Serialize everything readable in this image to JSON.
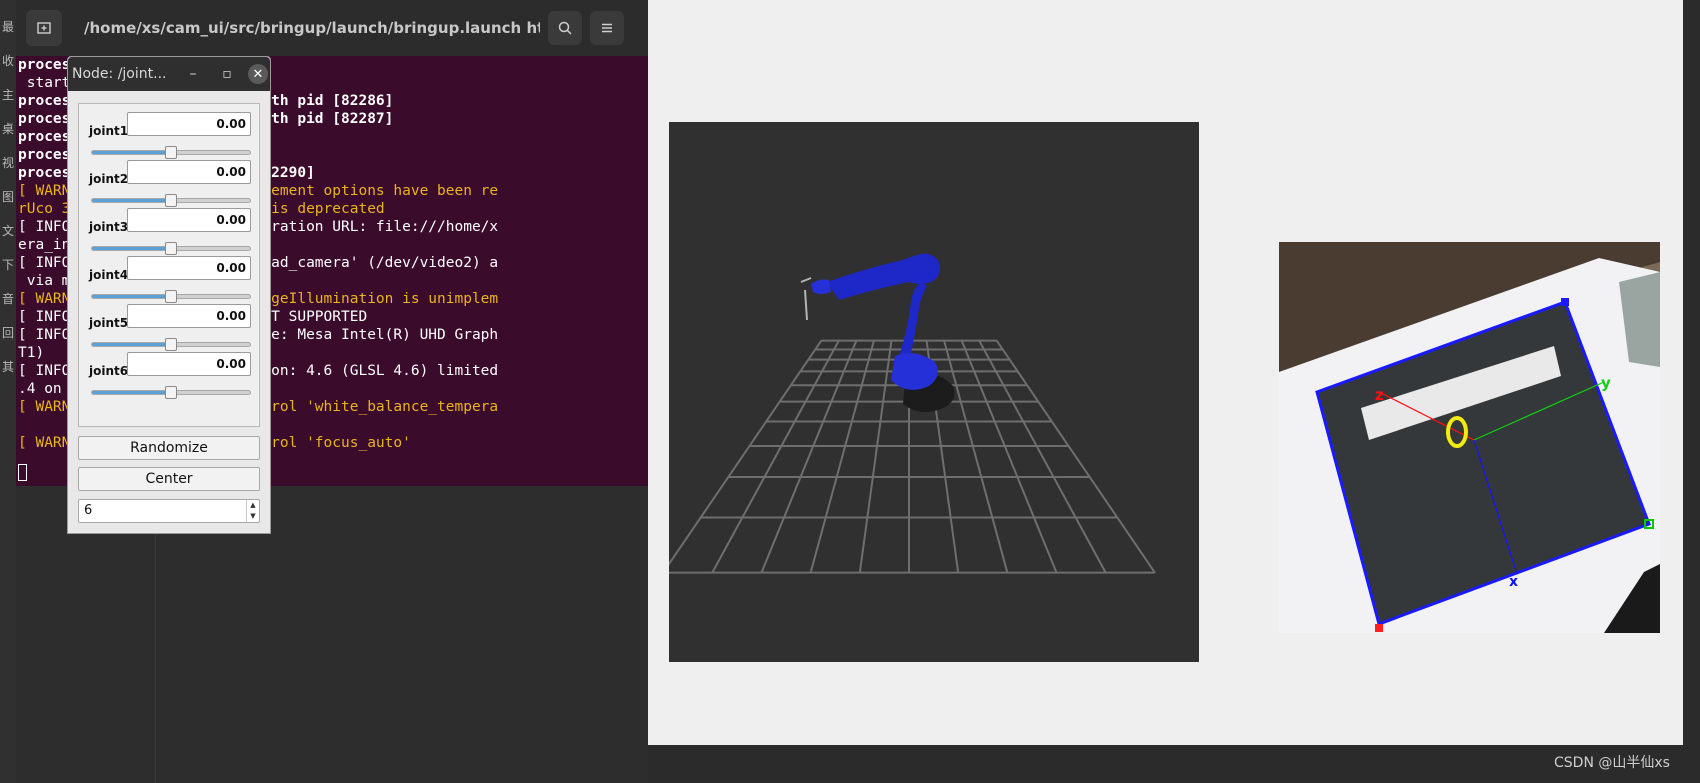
{
  "sidebar_chars": [
    "最",
    "收",
    "主",
    "桌",
    "视",
    "图",
    "文",
    "下",
    "音",
    "回",
    "其"
  ],
  "terminal": {
    "title": "/home/xs/cam_ui/src/bringup/launch/bringup.launch http://...",
    "lines": [
      {
        "text": "proces       ith pid [82279]",
        "style": "wb"
      },
      {
        "text": " starte       t]",
        "style": "w"
      },
      {
        "text": "proces       r-2]: started with pid [82286]",
        "style": "wb"
      },
      {
        "text": "proces       r-3]: started with pid [82287]",
        "style": "wb"
      },
      {
        "text": "proces       pid [82288]",
        "style": "wb"
      },
      {
        "text": "proces       with pid [82289]",
        "style": "wb"
      },
      {
        "text": "proces       rted with pid [82290]",
        "style": "wb"
      },
      {
        "text": "[ WARN       3]: Corner refinement options have been re",
        "style": "y"
      },
      {
        "text": "rUco 3       t ROS parameter is deprecated",
        "style": "y"
      },
      {
        "text": "[ INFO       3]: camera calibration URL: file:///home/x",
        "style": "w"
      },
      {
        "text": "era_in",
        "style": "w"
      },
      {
        "text": "[ INFO       9]: Starting 'head_camera' (/dev/video2) a",
        "style": "w"
      },
      {
        "text": " via m",
        "style": "w"
      },
      {
        "text": "[ WARN       3]: normalizeImageIllumination is unimplem",
        "style": "y"
      },
      {
        "text": "[ INFO       5]: Stereo is NOT SUPPORTED",
        "style": "w"
      },
      {
        "text": "[ INFO       9]: OpenGL device: Mesa Intel(R) UHD Graph",
        "style": "w"
      },
      {
        "text": "T1)",
        "style": "w"
      },
      {
        "text": "[ INFO       1]: OpenGl version: 4.6 (GLSL 4.6) limited",
        "style": "w"
      },
      {
        "text": ".4 on",
        "style": "w"
      },
      {
        "text": "[ WARN       4]: unknown control 'white_balance_tempera",
        "style": "y"
      },
      {
        "text": "",
        "style": "w"
      },
      {
        "text": "[ WARN       1]: unknown control 'focus_auto'",
        "style": "y"
      }
    ]
  },
  "jsp": {
    "title": "Node: /joint...",
    "minimize": "–",
    "maximize": "▫",
    "close": "✕",
    "joints": [
      {
        "label": "joint1",
        "value": "0.00",
        "fraction": 0.5
      },
      {
        "label": "joint2",
        "value": "0.00",
        "fraction": 0.5
      },
      {
        "label": "joint3",
        "value": "0.00",
        "fraction": 0.5
      },
      {
        "label": "joint4",
        "value": "0.00",
        "fraction": 0.5
      },
      {
        "label": "joint5",
        "value": "0.00",
        "fraction": 0.5
      },
      {
        "label": "joint6",
        "value": "0.00",
        "fraction": 0.5
      }
    ],
    "randomize_label": "Randomize",
    "center_label": "Center",
    "spin_value": "6"
  },
  "camera_axes": {
    "z": "z",
    "y": "y",
    "x": "x"
  },
  "watermark": "CSDN @山半仙xs",
  "colors": {
    "terminal_bg": "#3b0b2b",
    "warn": "#e9b321",
    "robot": "#1e28c8",
    "marker_border": "#1a1aff"
  }
}
